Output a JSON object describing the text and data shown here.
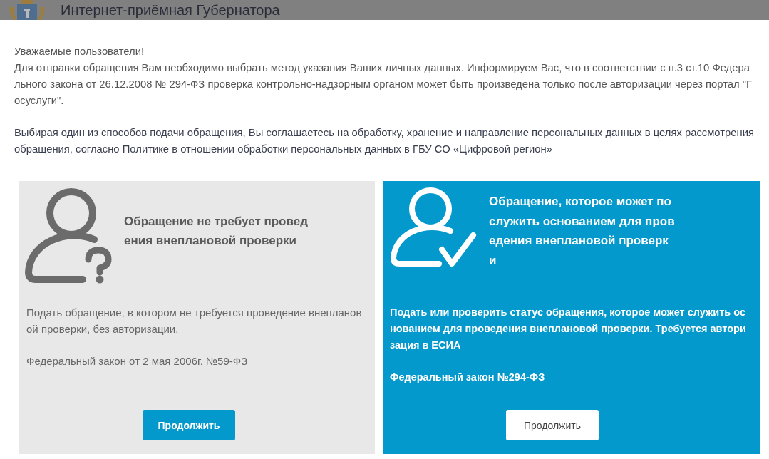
{
  "header": {
    "title": "Интернет-приёмная Губернатора"
  },
  "notice": {
    "greeting": "Уважаемые пользователи!",
    "text": "Для отправки обращения Вам необходимо выбрать метод указания Ваших личных данных. Информируем Вас, что в соответствии с п.3 ст.10 Федерального закона от 26.12.2008 № 294-ФЗ проверка контрольно-надзорным органом может быть произведена только после авторизации через портал \"Госуслуги\".",
    "consent": "Выбирая один из способов подачи обращения, Вы соглашаетесь на обработку, хранение и направление персональных данных в целях рассмотрения обращения, согласно",
    "policy_link": "Политике в отношении обработки персональных данных в ГБУ СО «Цифровой регион»"
  },
  "options": [
    {
      "kind": "anonymous",
      "selected": false,
      "title": "Обращение не требует проведения внеплановой проверки",
      "description": "Подать обращение, в котором не требуется проведение внеплановой проверки, без авторизации.",
      "law": "Федеральный закон от 2 мая 2006г. №59-ФЗ",
      "button": "Продолжить"
    },
    {
      "kind": "authorized",
      "selected": true,
      "title": "Обращение, которое может послужить основанием для проведения внеплановой проверки",
      "description": "Подать или проверить статус обращения, которое может служить основанием для проведения внеплановой проверки. Требуется авторизация в ЕСИА",
      "law": "Федеральный закон №294-ФЗ",
      "button": "Продолжить"
    }
  ]
}
